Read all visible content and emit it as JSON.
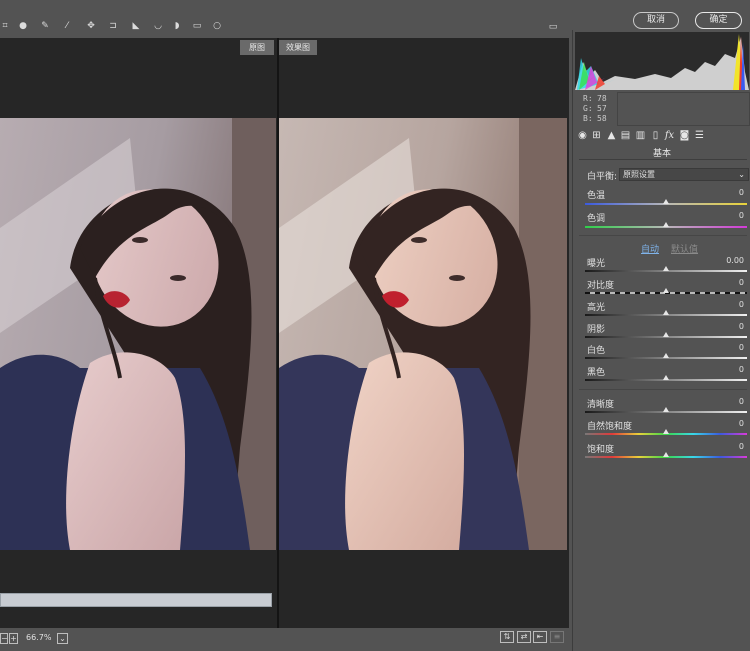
{
  "toolbar": {
    "cancel_label": "取消",
    "ok_label": "确定",
    "tools": [
      "crop-tool-icon",
      "circle-tool-icon",
      "brush-tool-icon",
      "eyedropper-icon",
      "target-adjust-icon",
      "crop-icon",
      "straighten-icon",
      "rotate-ccw-icon",
      "rotate-cw-icon",
      "preferences-icon",
      "redeye-icon"
    ]
  },
  "preview": {
    "before_label": "原图",
    "after_label": "效果图"
  },
  "bottom": {
    "zoom_out": "−",
    "zoom_in": "+",
    "zoom_value": "66.7%",
    "zoom_caret": "⌄"
  },
  "histogram": {
    "r_label": "R:",
    "r_value": "78",
    "g_label": "G:",
    "g_value": "57",
    "b_label": "B:",
    "b_value": "58"
  },
  "panel": {
    "section_title": "基本",
    "white_balance_label": "白平衡:",
    "white_balance_value": "原照设置",
    "auto_label": "自动",
    "default_label": "默认值",
    "sliders": [
      {
        "key": "temperature",
        "label": "色温",
        "value": "0",
        "position": 0.5
      },
      {
        "key": "tint",
        "label": "色调",
        "value": "0",
        "position": 0.5
      },
      {
        "key": "exposure",
        "label": "曝光",
        "value": "0.00",
        "position": 0.5
      },
      {
        "key": "contrast",
        "label": "对比度",
        "value": "0",
        "position": 0.5
      },
      {
        "key": "highlights",
        "label": "高光",
        "value": "0",
        "position": 0.5
      },
      {
        "key": "shadows",
        "label": "阴影",
        "value": "0",
        "position": 0.5
      },
      {
        "key": "whites",
        "label": "白色",
        "value": "0",
        "position": 0.5
      },
      {
        "key": "blacks",
        "label": "黑色",
        "value": "0",
        "position": 0.5
      },
      {
        "key": "clarity",
        "label": "清晰度",
        "value": "0",
        "position": 0.5
      },
      {
        "key": "vibrance",
        "label": "自然饱和度",
        "value": "0",
        "position": 0.5
      },
      {
        "key": "saturation",
        "label": "饱和度",
        "value": "0",
        "position": 0.5
      }
    ]
  },
  "colors": {
    "accent_link": "#7fb3ea",
    "disabled_link": "#8a8a8a"
  }
}
